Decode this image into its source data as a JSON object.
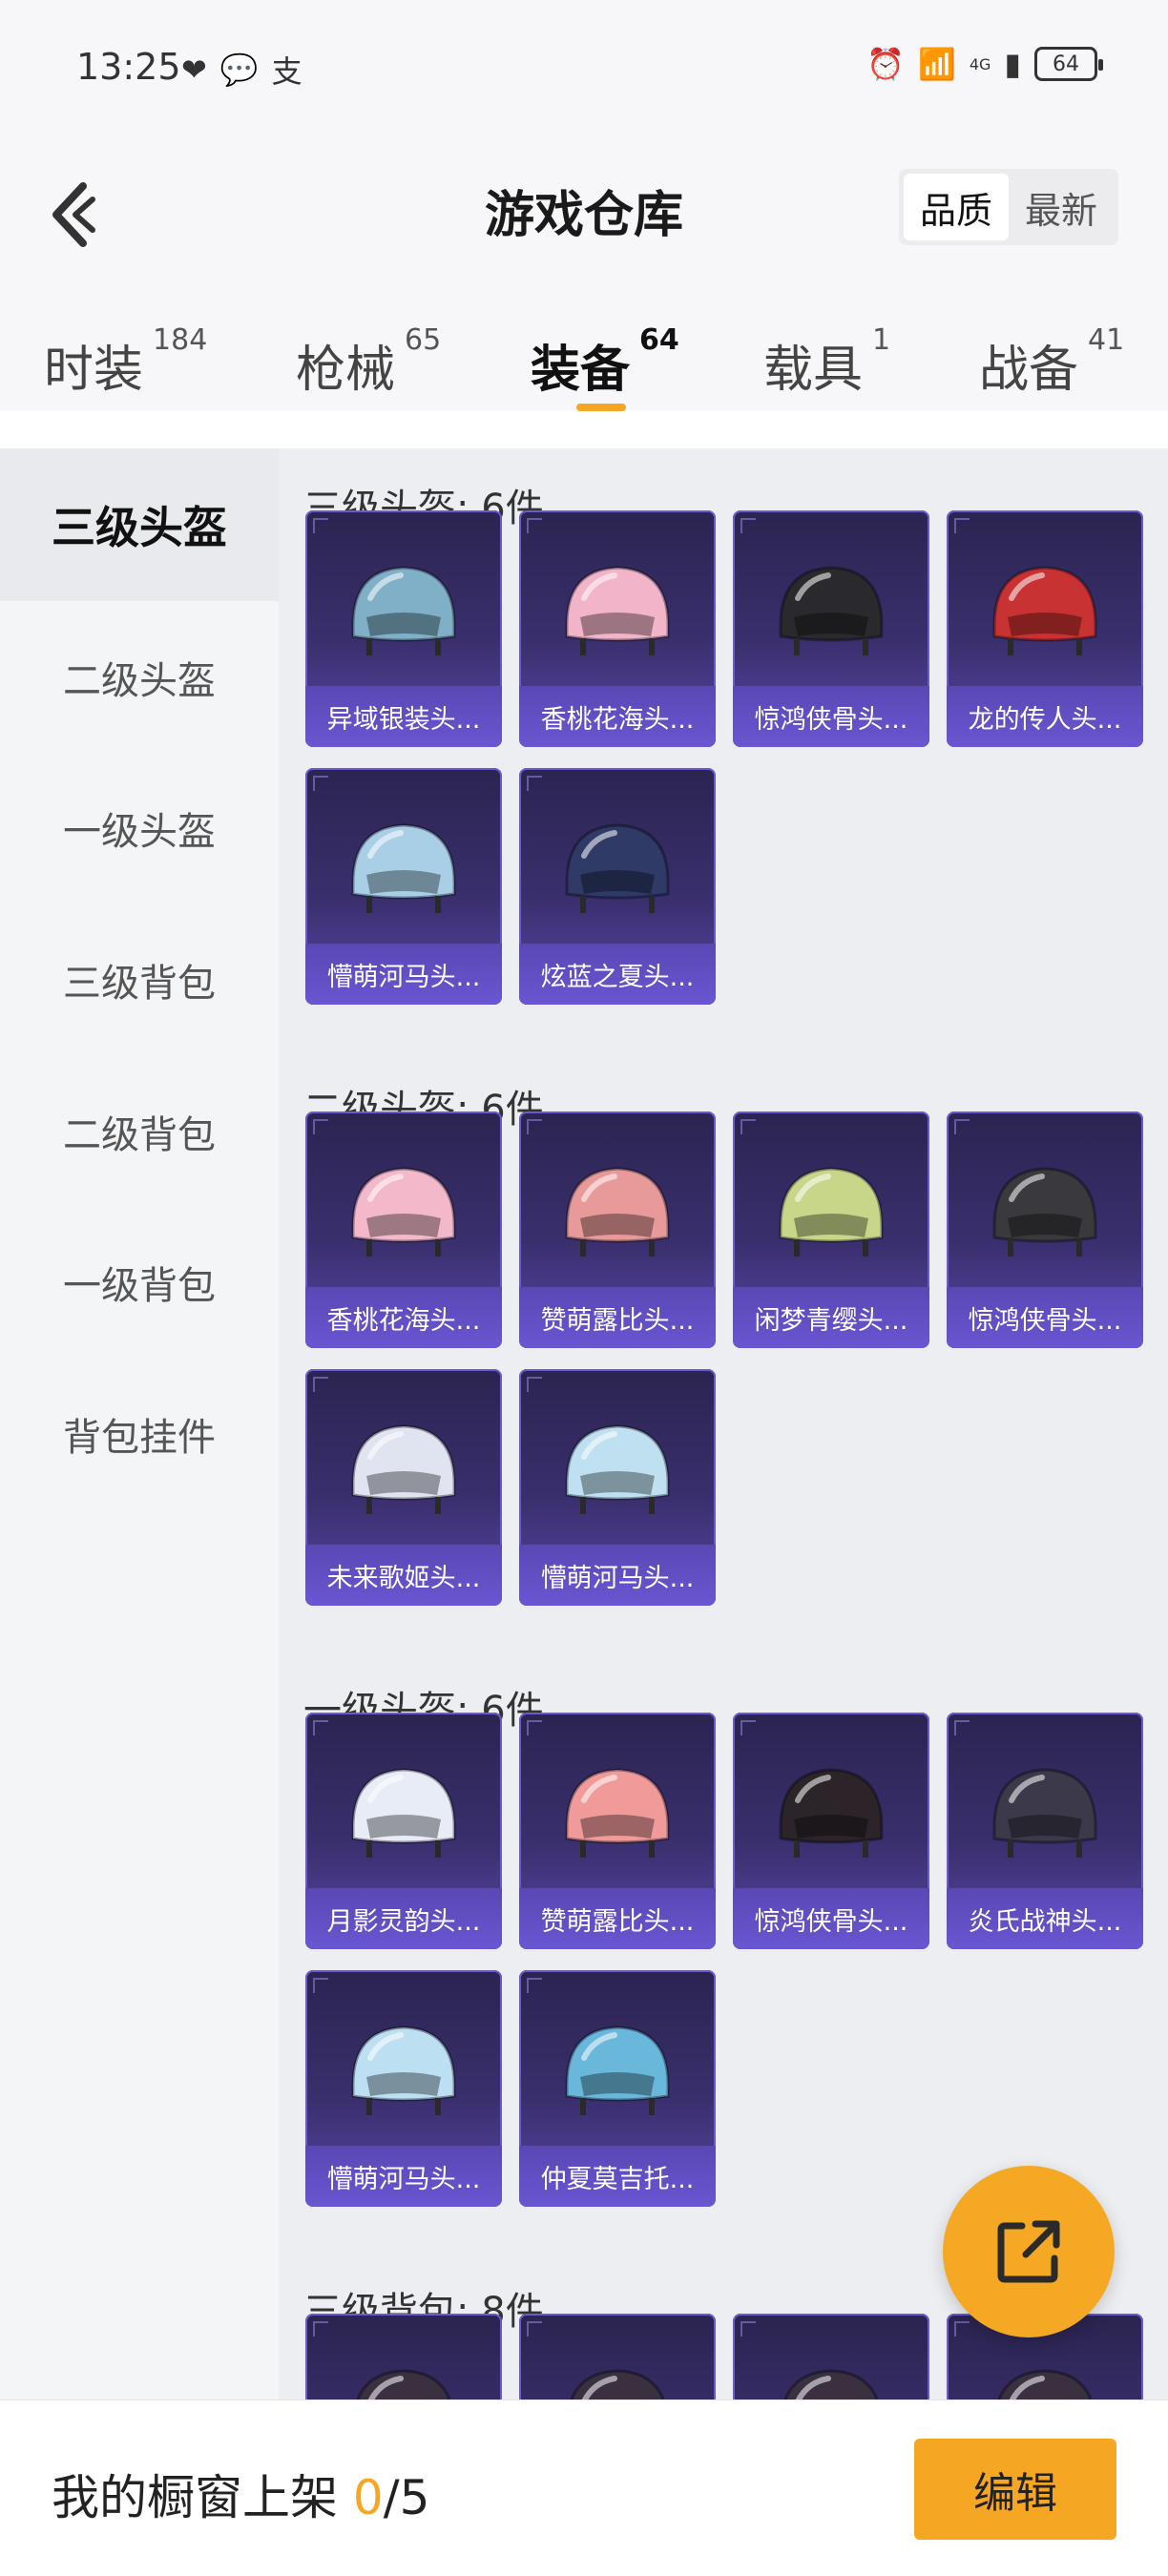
{
  "status_bar": {
    "time": "13:25",
    "network": "4G",
    "battery": "64"
  },
  "header": {
    "title": "游戏仓库",
    "sort_options": [
      "品质",
      "最新"
    ],
    "sort_active": "品质"
  },
  "tabs": [
    {
      "label": "时装",
      "count": "184"
    },
    {
      "label": "枪械",
      "count": "65"
    },
    {
      "label": "装备",
      "count": "64"
    },
    {
      "label": "载具",
      "count": "1"
    },
    {
      "label": "战备",
      "count": "41"
    }
  ],
  "active_tab": "装备",
  "sidebar": {
    "items": [
      "三级头盔",
      "二级头盔",
      "一级头盔",
      "三级背包",
      "二级背包",
      "一级背包",
      "背包挂件"
    ],
    "active": "三级头盔"
  },
  "sections": [
    {
      "title": "三级头盔: 6件",
      "items": [
        {
          "name": "异域银装头...",
          "color": "#7fb0c8"
        },
        {
          "name": "香桃花海头...",
          "color": "#f2b4c8"
        },
        {
          "name": "惊鸿侠骨头...",
          "color": "#2a2a2e"
        },
        {
          "name": "龙的传人头...",
          "color": "#c83232"
        },
        {
          "name": "懵萌河马头...",
          "color": "#a9cfe6"
        },
        {
          "name": "炫蓝之夏头...",
          "color": "#2f3a66"
        }
      ]
    },
    {
      "title": "二级头盔: 6件",
      "items": [
        {
          "name": "香桃花海头...",
          "color": "#f3b8c9"
        },
        {
          "name": "赞萌露比头...",
          "color": "#e89a9a"
        },
        {
          "name": "闲梦青缨头...",
          "color": "#c8d68a"
        },
        {
          "name": "惊鸿侠骨头...",
          "color": "#3a3a3e"
        },
        {
          "name": "未来歌姬头...",
          "color": "#dfe4f0"
        },
        {
          "name": "懵萌河马头...",
          "color": "#bfe0f0"
        }
      ]
    },
    {
      "title": "一级头盔: 6件",
      "items": [
        {
          "name": "月影灵韵头...",
          "color": "#e8ecf7"
        },
        {
          "name": "赞萌露比头...",
          "color": "#f09a9a"
        },
        {
          "name": "惊鸿侠骨头...",
          "color": "#2c2428"
        },
        {
          "name": "炎氏战神头...",
          "color": "#3c3a4a"
        },
        {
          "name": "懵萌河马头...",
          "color": "#bcdff2"
        },
        {
          "name": "仲夏莫吉托...",
          "color": "#6ab7dc"
        }
      ]
    },
    {
      "title": "三级背包: 8件",
      "items": [
        {
          "name": "",
          "color": "#3a3040"
        },
        {
          "name": "",
          "color": "#3a3040"
        },
        {
          "name": "",
          "color": "#3a3040"
        },
        {
          "name": "",
          "color": "#3a3040"
        }
      ]
    }
  ],
  "bottom_bar": {
    "shelf_label": "我的橱窗上架",
    "shelf_count": "0",
    "shelf_total": "/5",
    "edit_label": "编辑"
  }
}
